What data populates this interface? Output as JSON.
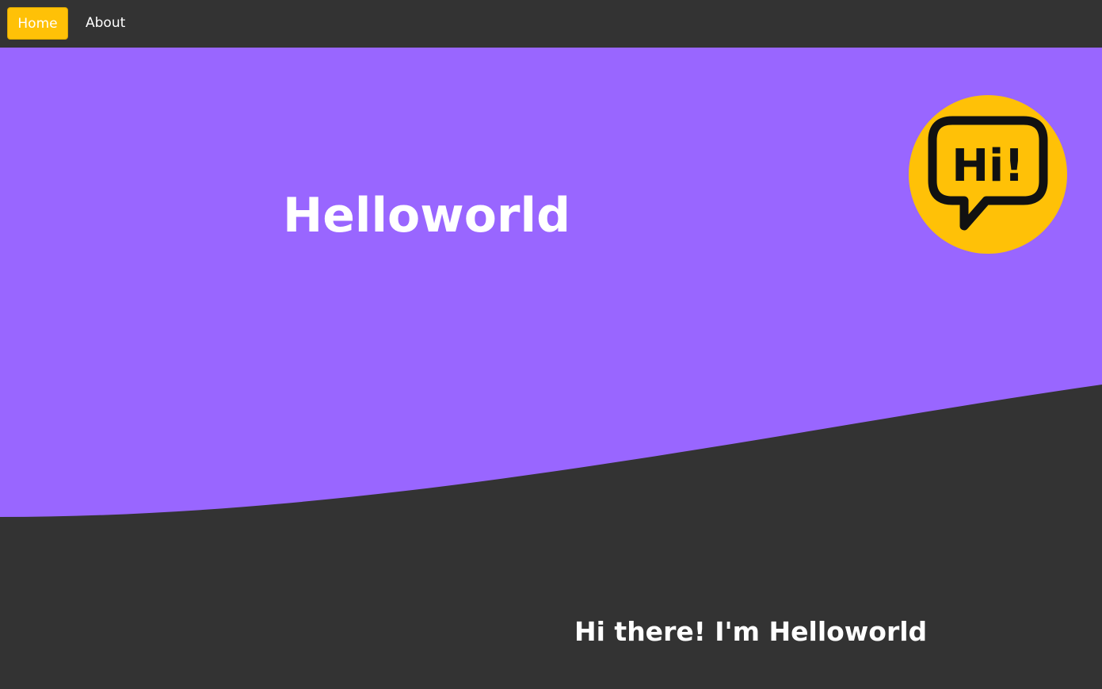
{
  "nav": {
    "items": [
      {
        "label": "Home",
        "active": true
      },
      {
        "label": "About",
        "active": false
      }
    ],
    "active_color": "#ffc107",
    "background_color": "#333333"
  },
  "hero": {
    "title": "Helloworld",
    "background_color": "#9966ff",
    "logo": {
      "icon": "hi-speech-bubble-icon",
      "text": "Hi!",
      "circle_color": "#ffc107"
    }
  },
  "section": {
    "tagline": "Hi there! I'm Helloworld",
    "background_color": "#333333"
  }
}
